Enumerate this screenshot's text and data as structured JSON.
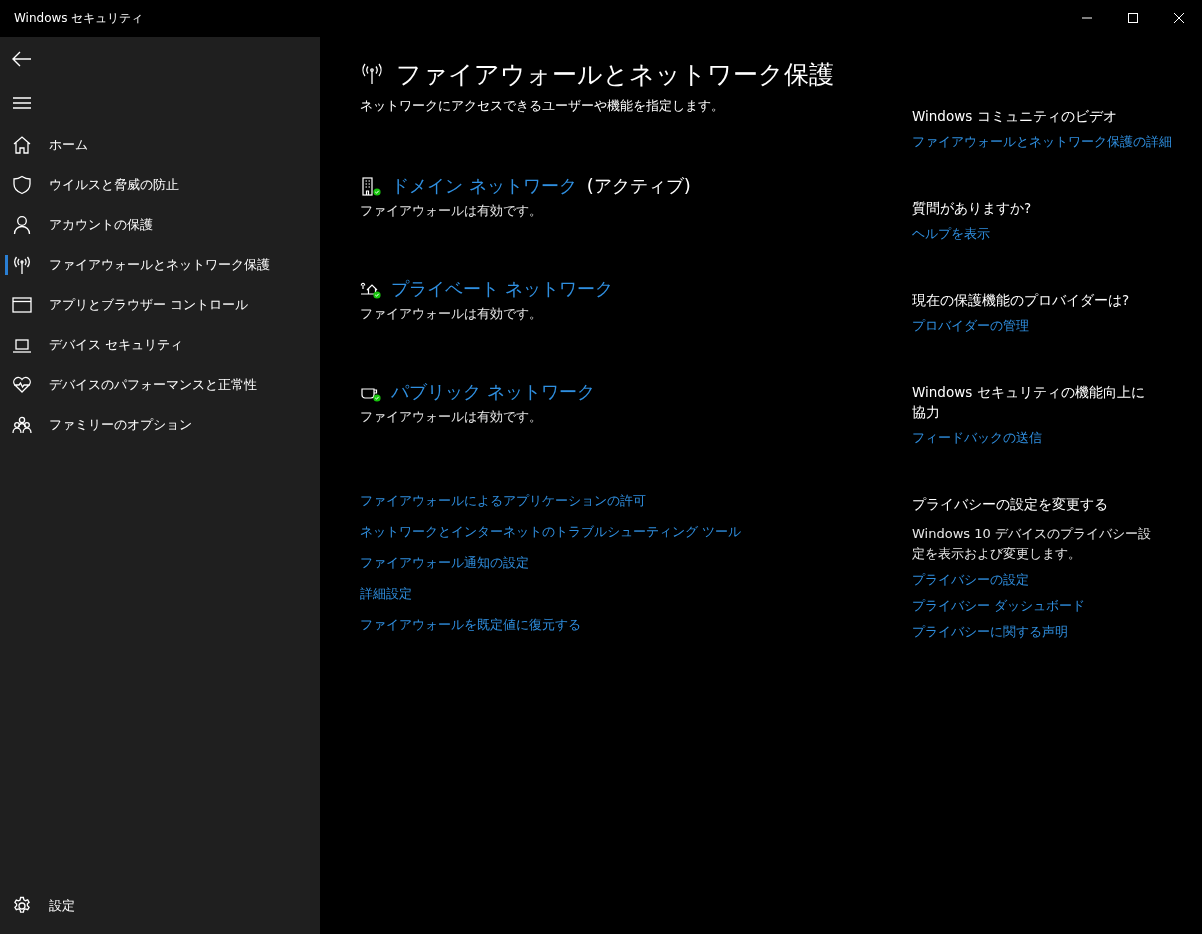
{
  "window": {
    "title": "Windows セキュリティ"
  },
  "sidebar": {
    "items": [
      {
        "kind": "home",
        "label": "ホーム",
        "selected": false
      },
      {
        "kind": "shield",
        "label": "ウイルスと脅威の防止",
        "selected": false
      },
      {
        "kind": "person",
        "label": "アカウントの保護",
        "selected": false
      },
      {
        "kind": "antenna",
        "label": "ファイアウォールとネットワーク保護",
        "selected": true
      },
      {
        "kind": "browser",
        "label": "アプリとブラウザー コントロール",
        "selected": false
      },
      {
        "kind": "laptop",
        "label": "デバイス セキュリティ",
        "selected": false
      },
      {
        "kind": "heart",
        "label": "デバイスのパフォーマンスと正常性",
        "selected": false
      },
      {
        "kind": "family",
        "label": "ファミリーのオプション",
        "selected": false
      }
    ],
    "settings": {
      "label": "設定"
    }
  },
  "page": {
    "title": "ファイアウォールとネットワーク保護",
    "description": "ネットワークにアクセスできるユーザーや機能を指定します。"
  },
  "networks": [
    {
      "kind": "domain",
      "name": "ドメイン ネットワーク",
      "status": "(アクティブ)",
      "description": "ファイアウォールは有効です。"
    },
    {
      "kind": "private",
      "name": "プライベート ネットワーク",
      "description": "ファイアウォールは有効です。"
    },
    {
      "kind": "public",
      "name": "パブリック ネットワーク",
      "description": "ファイアウォールは有効です。"
    }
  ],
  "links": [
    "ファイアウォールによるアプリケーションの許可",
    "ネットワークとインターネットのトラブルシューティング ツール",
    "ファイアウォール通知の設定",
    "詳細設定",
    "ファイアウォールを既定値に復元する"
  ],
  "side_sections": [
    {
      "heading": "Windows コミュニティのビデオ",
      "links": [
        "ファイアウォールとネットワーク保護の詳細"
      ]
    },
    {
      "heading": "質問がありますか?",
      "links": [
        "ヘルプを表示"
      ]
    },
    {
      "heading": "現在の保護機能のプロバイダーは?",
      "links": [
        "プロバイダーの管理"
      ]
    },
    {
      "heading": "Windows セキュリティの機能向上に協力",
      "links": [
        "フィードバックの送信"
      ]
    },
    {
      "heading": "プライバシーの設定を変更する",
      "description": "Windows 10 デバイスのプライバシー設定を表示および変更します。",
      "links": [
        "プライバシーの設定",
        "プライバシー ダッシュボード",
        "プライバシーに関する声明"
      ]
    }
  ]
}
